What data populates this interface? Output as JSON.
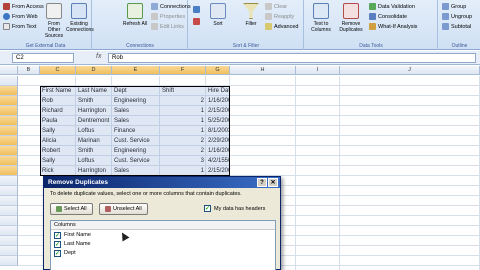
{
  "ribbon": {
    "groups": {
      "external": {
        "label": "Get External Data",
        "from_access": "From Access",
        "from_web": "From Web",
        "from_text": "From Text",
        "from_other": "From Other Sources",
        "existing": "Existing Connections"
      },
      "connections": {
        "label": "Connections",
        "refresh": "Refresh All",
        "connections": "Connections",
        "properties": "Properties",
        "edit_links": "Edit Links"
      },
      "sort_filter": {
        "label": "Sort & Filter",
        "sort": "Sort",
        "filter": "Filter",
        "clear": "Clear",
        "reapply": "Reapply",
        "advanced": "Advanced"
      },
      "data_tools": {
        "label": "Data Tools",
        "text_to_columns": "Text to Columns",
        "remove_duplicates": "Remove Duplicates",
        "validation": "Data Validation",
        "consolidate": "Consolidate",
        "whatif": "What-If Analysis"
      },
      "outline": {
        "label": "Outline",
        "group": "Group",
        "ungroup": "Ungroup",
        "subtotal": "Subtotal"
      }
    }
  },
  "formula_bar": {
    "name_box": "C2",
    "fx": "fx",
    "content": "Rob"
  },
  "sheet": {
    "columns": [
      "B",
      "C",
      "D",
      "E",
      "F",
      "G",
      "H",
      "I",
      "J"
    ],
    "rows": [
      [
        "First Name",
        "Last Name",
        "Dept",
        "Shift",
        "Hire Date"
      ],
      [
        "Rob",
        "Smith",
        "Engineering",
        "2",
        "1/16/2008"
      ],
      [
        "Richard",
        "Harrington",
        "Sales",
        "1",
        "2/15/2008"
      ],
      [
        "Paula",
        "Dentremont",
        "Sales",
        "1",
        "5/25/2001"
      ],
      [
        "Sally",
        "Loftus",
        "Finance",
        "1",
        "8/1/2003"
      ],
      [
        "Alicia",
        "Marinan",
        "Cust. Service",
        "2",
        "2/29/2008"
      ],
      [
        "Robert",
        "Smith",
        "Engineering",
        "2",
        "1/16/2008"
      ],
      [
        "Sally",
        "Loftus",
        "Cust. Service",
        "3",
        "4/2/1550"
      ],
      [
        "Rick",
        "Harrington",
        "Sales",
        "1",
        "2/15/2008"
      ]
    ]
  },
  "dialog": {
    "title": "Remove Duplicates",
    "help": "?",
    "close": "✕",
    "instruction": "To delete duplicate values, select one or more columns that contain duplicates.",
    "select_all": "Select All",
    "unselect_all": "Unselect All",
    "headers_label": "My data has headers",
    "list_header": "Columns",
    "columns": [
      "First Name",
      "Last Name",
      "Dept"
    ]
  },
  "colors": {
    "ribbon": "#cfe0f4",
    "selection": "#82a0d2",
    "dialog_title": "#0a246a"
  }
}
